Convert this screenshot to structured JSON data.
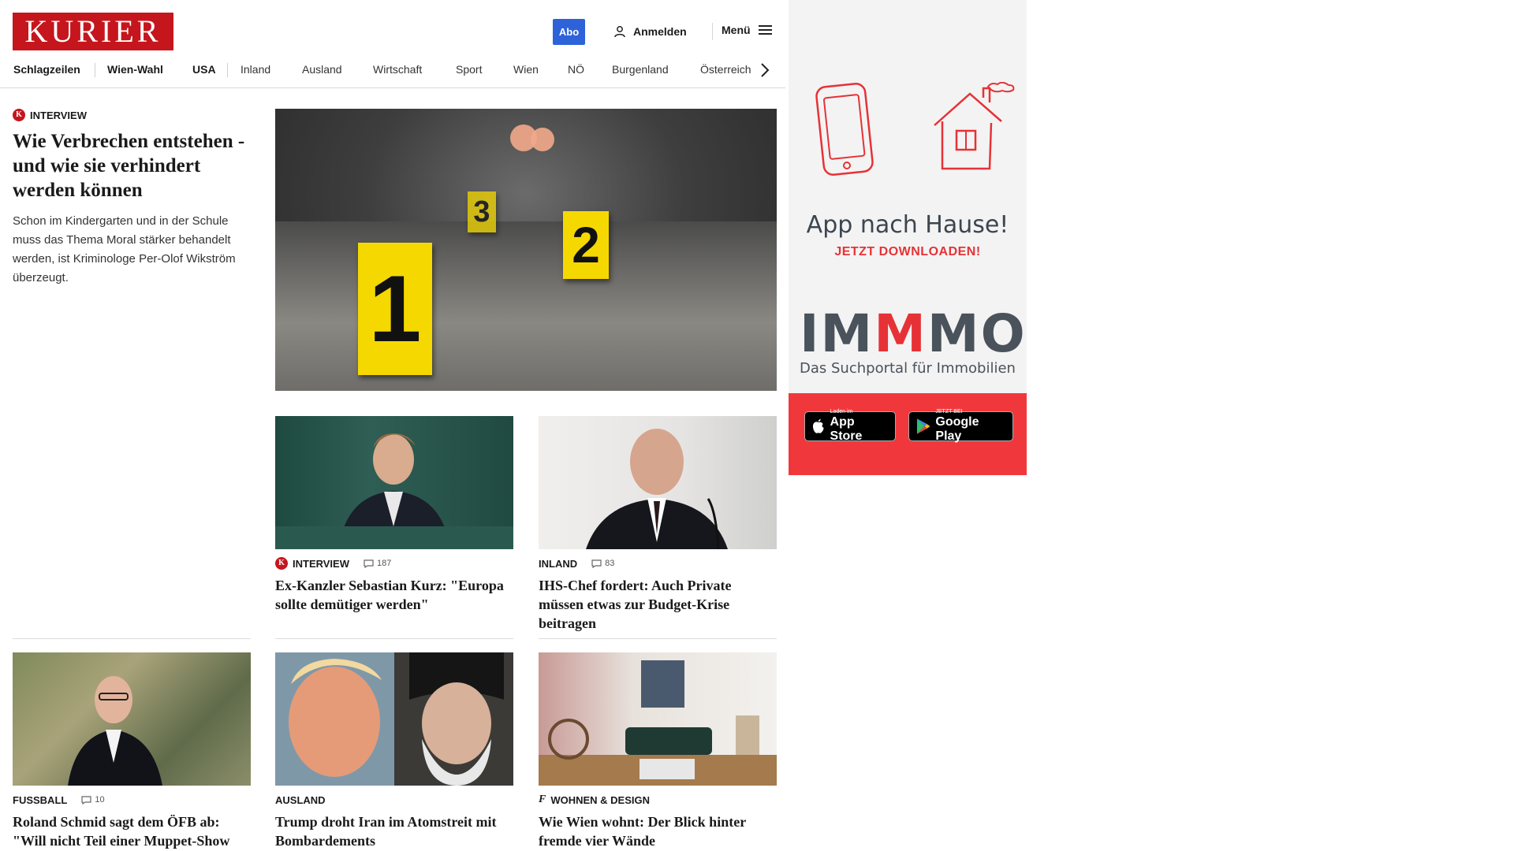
{
  "header": {
    "logo": "KURIER",
    "abo_label": "Abo",
    "login_label": "Anmelden",
    "menu_label": "Menü"
  },
  "nav": {
    "items": [
      "Schlagzeilen",
      "Wien-Wahl",
      "USA",
      "Inland",
      "Ausland",
      "Wirtschaft",
      "Sport",
      "Wien",
      "NÖ",
      "Burgenland",
      "Österreich"
    ]
  },
  "lead": {
    "kicker": "INTERVIEW",
    "kicker_badge": "K",
    "title": "Wie Verbrechen entstehen - und wie sie verhindert werden können",
    "teaser": "Schon im Kindergarten und in der Schule muss das Thema Moral stärker behandelt werden, ist Kriminologe Per-Olof Wikström überzeugt.",
    "image_markers": [
      "1",
      "2",
      "3"
    ]
  },
  "cards": [
    {
      "kicker": "INTERVIEW",
      "badge": "K",
      "comments": "187",
      "title": "Ex-Kanzler Sebastian Kurz: \"Europa sollte demütiger werden\""
    },
    {
      "kicker": "INLAND",
      "comments": "83",
      "title": "IHS-Chef fordert: Auch Private müssen etwas zur Budget-Krise beitragen"
    },
    {
      "kicker": "FUSSBALL",
      "comments": "10",
      "title": "Roland Schmid sagt dem ÖFB ab: \"Will nicht Teil einer Muppet-Show sein\""
    },
    {
      "kicker": "AUSLAND",
      "title": "Trump droht Iran im Atomstreit mit Bombardements"
    },
    {
      "kicker": "WOHNEN & DESIGN",
      "badge": "f",
      "title": "Wie Wien wohnt: Der Blick hinter fremde vier Wände"
    }
  ],
  "ad": {
    "headline": "App nach Hause!",
    "subline": "JETZT DOWNLOADEN!",
    "brand_parts": [
      "IM",
      "M",
      "MO"
    ],
    "tagline": "Das Suchportal für Immobilien",
    "appstore_small": "Laden im",
    "appstore_big": "App Store",
    "googleplay_small": "JETZT BEI",
    "googleplay_big": "Google Play"
  },
  "colors": {
    "brand_red": "#c5161d",
    "abo_blue": "#2e62d9",
    "ad_red": "#f0383c"
  }
}
